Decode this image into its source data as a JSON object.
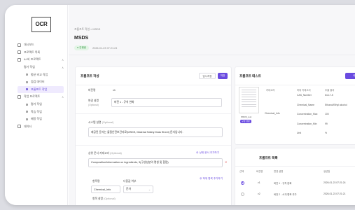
{
  "logo": "OCR",
  "nav": [
    {
      "label": "대시보드",
      "lvl": 1
    },
    {
      "label": "프로젝트 목록",
      "lvl": 1
    },
    {
      "label": "AI 비 프로젝트",
      "lvl": 1,
      "chev": "∧"
    },
    {
      "label": "평가 작업",
      "lvl": 2,
      "chev": "∧"
    },
    {
      "label": "평균 비교 작업",
      "lvl": 3
    },
    {
      "label": "점검 데이터",
      "lvl": 3
    },
    {
      "label": "프롬프트 작업",
      "lvl": 3,
      "active": true
    },
    {
      "label": "작업 프로젝트",
      "lvl": 1,
      "chev": "∧"
    },
    {
      "label": "평가 작업",
      "lvl": 3
    },
    {
      "label": "학습 작업",
      "lvl": 3
    },
    {
      "label": "배정 작업",
      "lvl": 3
    },
    {
      "label": "데이터",
      "lvl": 1
    }
  ],
  "breadcrumb": "프롬프트 작업  >  MSDS",
  "page_title": "MSDS",
  "status_badge": "● 진행중",
  "timestamp": "2026-01-23 07:21:24",
  "editor": {
    "title": "프롬프트 작성",
    "btn_save": "임시저장",
    "btn_submit": "저장",
    "version_label": "버전명",
    "version_value": "v1",
    "change_label": "변경 설명",
    "change_sub": "(Optional)",
    "change_value": "버전 1 - 규칙 완화",
    "system_label": "시스템 설명",
    "system_sub": "(Optional)",
    "system_value": "제공된 문서는 물질안전보건자료(MSDS, Material Safety Data Sheet) 문서입니다.",
    "parent_label": "상위 문서 카테고리",
    "parent_sub": "(Optional)",
    "parent_link": "⊕ 상위 문서 추가하기",
    "parent_value": "Composition/information on ingredients, 3(구성성분의 명칭 및 함량)",
    "field_link": "⊕ 하위 항목 추가하기",
    "field_label": "항목명",
    "field_value": "Chemical_Info",
    "dtype_label": "다중값 여부",
    "dtype_value": "문자",
    "extra_label": "항목 설명",
    "extra_sub": "(Optional)"
  },
  "test": {
    "title": "프롬프트 테스트",
    "btn": "테스트 실행",
    "head": [
      "문서",
      "카테고리",
      "하위 카테고리",
      "추출 결과"
    ],
    "category": "Chemical_Info",
    "doc_name": "MSDS_test",
    "tag": "구성 성분",
    "rows": [
      {
        "k": "CAS_Number",
        "v": "64-17-5"
      },
      {
        "k": "Chemical_Name",
        "v": "Ethanol/Ethyl alcohol"
      },
      {
        "k": "Concentration_Max",
        "v": "100"
      },
      {
        "k": "Concentration_Min",
        "v": "99"
      },
      {
        "k": "Unit",
        "v": "%"
      }
    ]
  },
  "list": {
    "title": "프롬프트 목록",
    "head": [
      "선택",
      "버전명",
      "변경 설명",
      "생성일"
    ],
    "rows": [
      {
        "ver": "v1",
        "desc": "버전 1 - 규칙 완화",
        "date": "2026-01-23 07:21:24",
        "on": true
      },
      {
        "ver": "v2",
        "desc": "버전 2 - 소개 항목 추가",
        "date": "2026-01-23 07:21:21",
        "on": false
      }
    ]
  },
  "colors": {
    "accent": "#6a4be0",
    "badge_bg": "#e3f5e6"
  }
}
